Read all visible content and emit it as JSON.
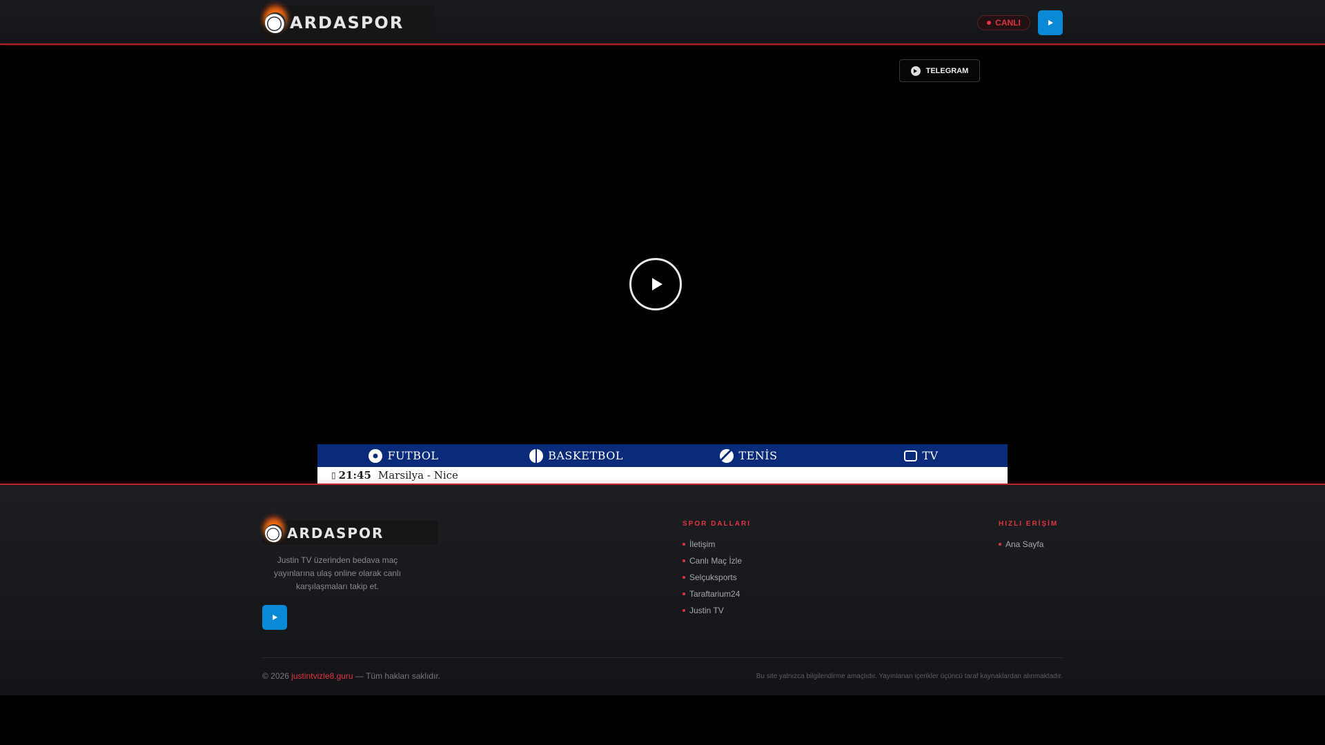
{
  "header": {
    "logo_text": "ARDASPOR",
    "live_label": "CANLI"
  },
  "player": {
    "telegram_label": "TELEGRAM"
  },
  "sport_tabs": [
    {
      "label": "FUTBOL",
      "icon": "soccer-ball-icon"
    },
    {
      "label": "BASKETBOL",
      "icon": "basketball-icon"
    },
    {
      "label": "TENİS",
      "icon": "tennis-ball-icon"
    },
    {
      "label": "TV",
      "icon": "tv-icon"
    }
  ],
  "matches": [
    {
      "time": "21:45",
      "name": "Marsilya - Nice"
    }
  ],
  "footer": {
    "logo_text": "ARDASPOR",
    "description": "Justin TV üzerinden bedava maç yayınlarına ulaş online olarak canlı karşılaşmaları takip et.",
    "col1_title": "SPOR DALLARI",
    "col1_items": [
      "İletişim",
      "Canlı Maç İzle",
      "Selçuksports",
      "Taraftarium24",
      "Justin TV"
    ],
    "col2_title": "HIZLI ERİŞİM",
    "col2_items": [
      "Ana Sayfa"
    ],
    "copyright_prefix": "© 2026",
    "copyright_site": "justintvizle8.guru",
    "copyright_suffix": "— Tüm hakları saklıdır.",
    "disclaimer": "Bu site yalnızca bilgilendirme amaçlıdır. Yayınlanan içerikler üçüncü taraf kaynaklardan alınmaktadır."
  },
  "colors": {
    "accent_red": "#e0353f",
    "telegram_blue": "#0a8ad6",
    "tabs_blue": "#0a2a7a"
  }
}
